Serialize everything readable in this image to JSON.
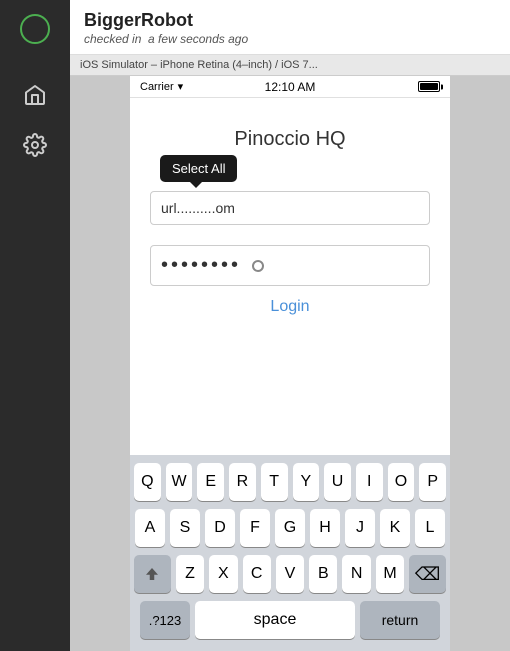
{
  "sidebar": {
    "logo_status": "online",
    "items": [
      {
        "label": "Home",
        "icon": "home"
      },
      {
        "label": "Settings",
        "icon": "gear"
      }
    ]
  },
  "topbar": {
    "title": "BiggerRobot",
    "status_prefix": "checked in",
    "status_time": "a few seconds ago"
  },
  "device_bar": {
    "label": "iOS Simulator – iPhone Retina (4–inch) / iOS 7..."
  },
  "phone": {
    "carrier": "Carrier",
    "time": "12:10 AM",
    "app_title": "Pinoccio HQ",
    "email_placeholder": "url..........om",
    "password_dots": "••••••••",
    "login_button": "Login",
    "context_menu": {
      "select_all_label": "Select All"
    }
  },
  "keyboard": {
    "row1": [
      "Q",
      "W",
      "E",
      "R",
      "T",
      "Y",
      "U",
      "I",
      "O",
      "P"
    ],
    "row2": [
      "A",
      "S",
      "D",
      "F",
      "G",
      "H",
      "J",
      "K",
      "L"
    ],
    "row3": [
      "Z",
      "X",
      "C",
      "V",
      "B",
      "N",
      "M"
    ],
    "space_label": "space",
    "return_label": "return",
    "symbols_label": ".?123",
    "shift_icon": "⇧",
    "delete_icon": "⌫"
  }
}
